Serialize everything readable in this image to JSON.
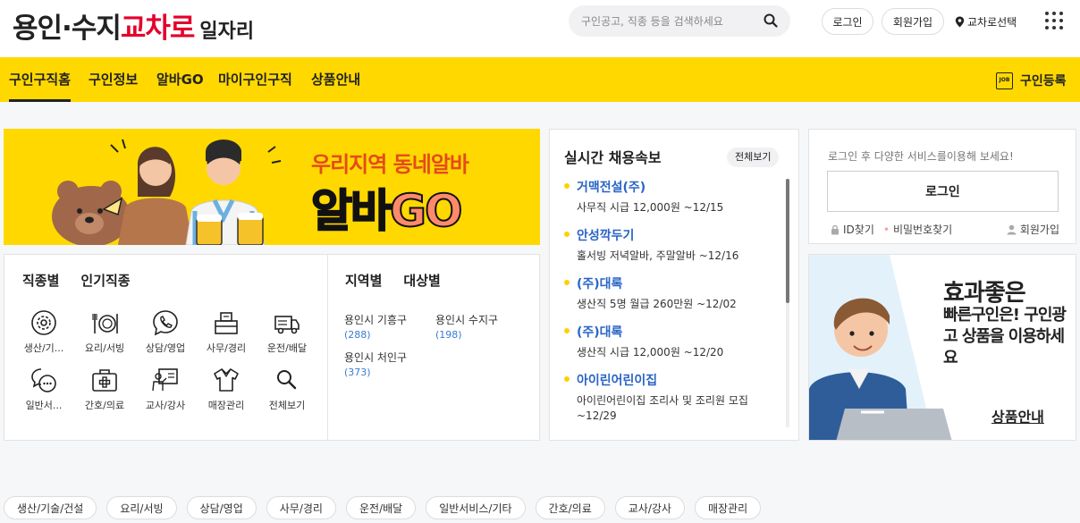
{
  "header": {
    "logo_part1": "용인·수지",
    "logo_part2": "교차로",
    "logo_part3": "일자리",
    "search_placeholder": "구인공고, 직종 등을 검색하세요",
    "login_label": "로그인",
    "join_label": "회원가입",
    "location_label": "교차로선택"
  },
  "nav": {
    "items": [
      {
        "label": "구인구직홈"
      },
      {
        "label": "구인정보"
      },
      {
        "label": "알바GO"
      },
      {
        "label": "마이구인구직"
      },
      {
        "label": "상품안내"
      }
    ],
    "register_icon_text": "JOB",
    "register_label": "구인등록"
  },
  "banner": {
    "title": "우리지역 동네알바",
    "big_part1": "알바",
    "big_part2": "GO"
  },
  "categories": {
    "tabs": [
      "직종별",
      "인기직종"
    ],
    "items": [
      {
        "label": "생산/기...",
        "icon": "gear-icon"
      },
      {
        "label": "요리/서빙",
        "icon": "dish-icon"
      },
      {
        "label": "상담/영업",
        "icon": "phone-icon"
      },
      {
        "label": "사무/경리",
        "icon": "office-icon"
      },
      {
        "label": "운전/배달",
        "icon": "truck-icon"
      },
      {
        "label": "일반서...",
        "icon": "chat-icon"
      },
      {
        "label": "간호/의료",
        "icon": "medical-icon"
      },
      {
        "label": "교사/강사",
        "icon": "teacher-icon"
      },
      {
        "label": "매장관리",
        "icon": "shirt-icon"
      },
      {
        "label": "전체보기",
        "icon": "search-icon"
      }
    ]
  },
  "regions": {
    "tabs": [
      "지역별",
      "대상별"
    ],
    "items": [
      {
        "name": "용인시 기흥구",
        "count": "(288)"
      },
      {
        "name": "용인시 수지구",
        "count": "(198)"
      },
      {
        "name": "용인시 처인구",
        "count": "(373)"
      }
    ]
  },
  "realtime": {
    "title": "실시간 채용속보",
    "all_label": "전체보기",
    "items": [
      {
        "company": "거맥전설(주)",
        "desc": "사무직 시급 12,000원 ~12/15"
      },
      {
        "company": "안성깍두기",
        "desc": "홀서빙 저녁알바, 주말알바 ~12/16"
      },
      {
        "company": "(주)대록",
        "desc": "생산직 5명 월급 260만원 ~12/02"
      },
      {
        "company": "(주)대록",
        "desc": "생산직 시급 12,000원 ~12/20"
      },
      {
        "company": "아이린어린이집",
        "desc": "아이린어린이집 조리사 및 조리원 모집 ~12/29"
      }
    ],
    "scroll_fraction": 0.5
  },
  "loginbox": {
    "message": "로그인 후 다양한 서비스를이용해 보세요!",
    "button_label": "로그인",
    "find_id": "ID찾기",
    "find_pw": "비밀번호찾기",
    "join": "회원가입"
  },
  "ad": {
    "line1": "효과좋은",
    "line2": "빠른구인은! 구인광고 상품을 이용하세요",
    "link": "상품안내"
  },
  "chips": [
    "생산/기술/건설",
    "요리/서빙",
    "상담/영업",
    "사무/경리",
    "운전/배달",
    "일반서비스/기타",
    "간호/의료",
    "교사/강사",
    "매장관리"
  ],
  "colors": {
    "brand_yellow": "#ffd800",
    "logo_red": "#e4002b",
    "link_blue": "#2a64c6"
  }
}
